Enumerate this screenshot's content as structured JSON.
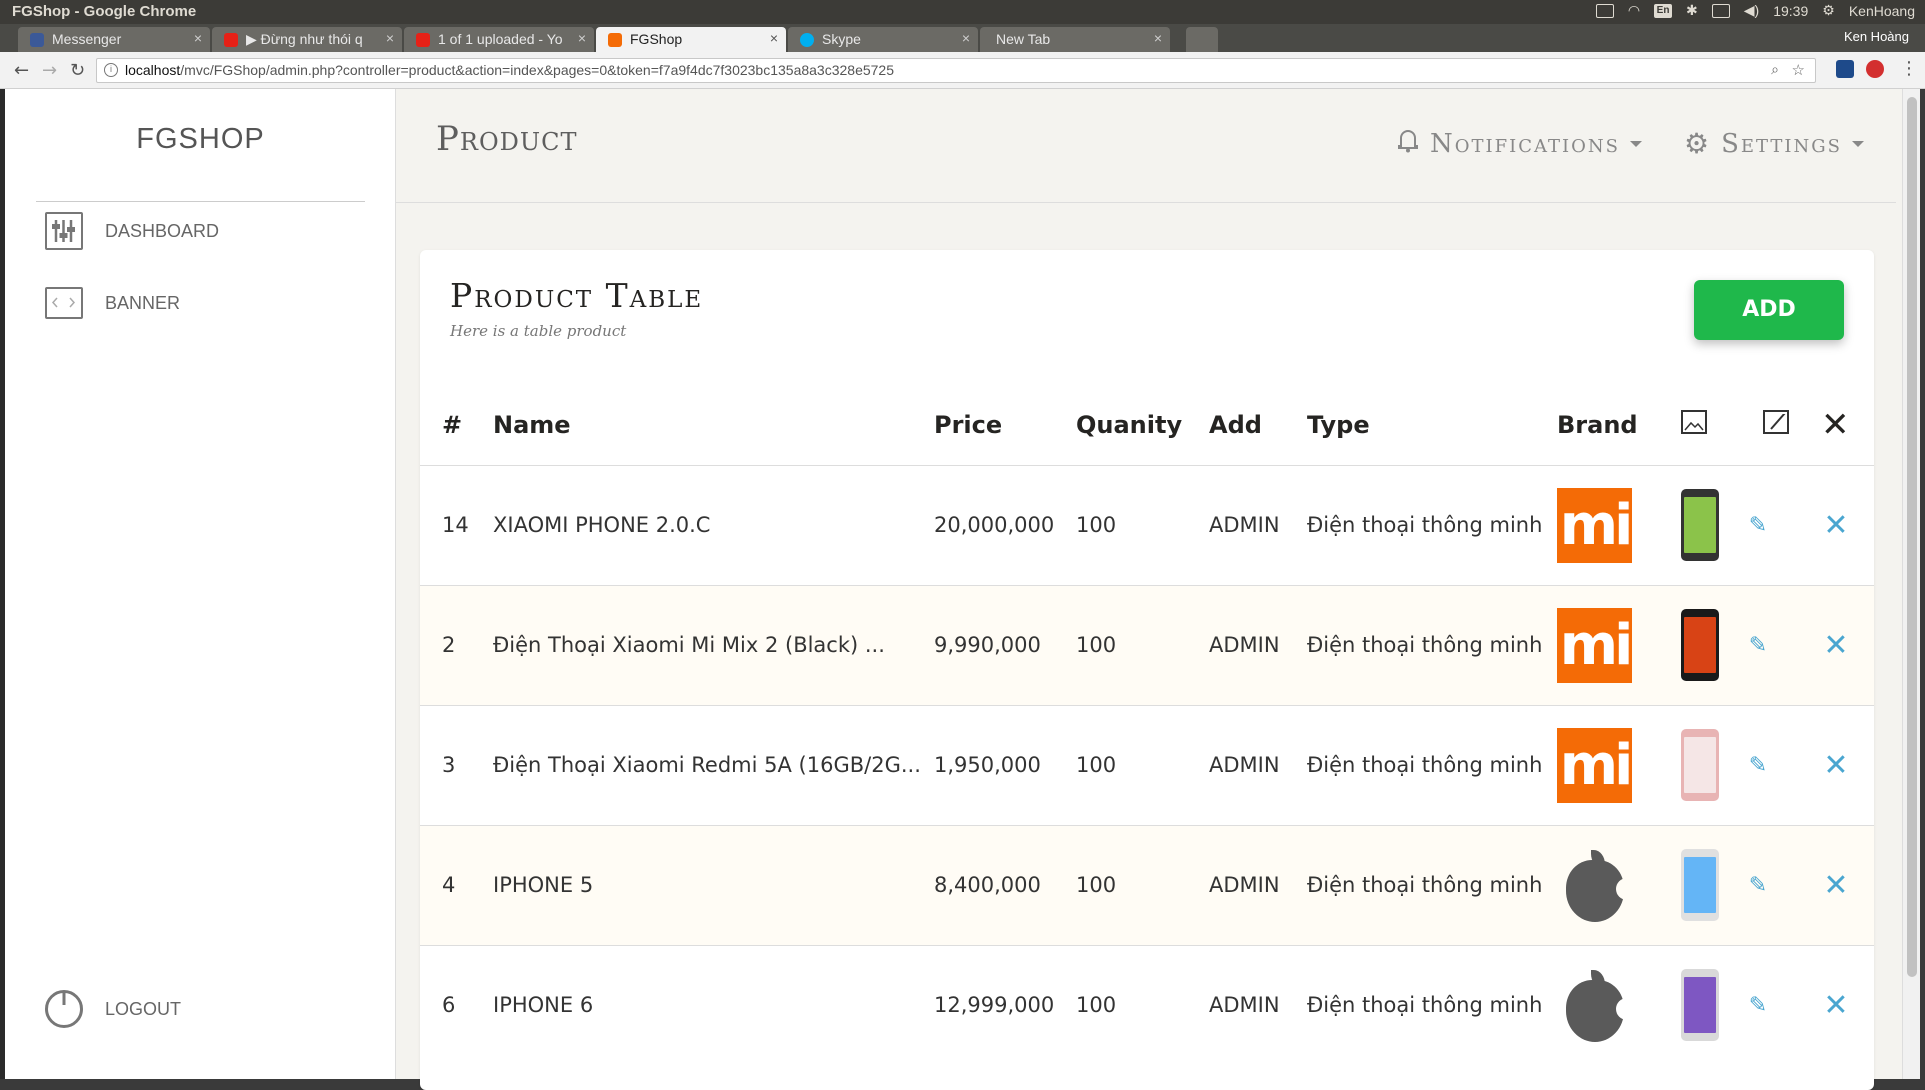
{
  "os": {
    "window_title": "FGShop - Google Chrome",
    "lang": "En",
    "time": "19:39",
    "user": "KenHoang"
  },
  "browser": {
    "tabs": [
      {
        "label": "Messenger",
        "favicon_color": "#3b5998"
      },
      {
        "label": "▶ Đừng như thói q",
        "favicon_color": "#e62117"
      },
      {
        "label": "1 of 1 uploaded - Yo",
        "favicon_color": "#e62117"
      },
      {
        "label": "FGShop",
        "favicon_color": "#f46b06",
        "active": true
      },
      {
        "label": "Skype",
        "favicon_color": "#00aff0"
      },
      {
        "label": "New Tab",
        "favicon_color": ""
      }
    ],
    "profile": "Ken Hoàng",
    "url_host": "localhost",
    "url_path": "/mvc/FGShop/admin.php?controller=product&action=index&pages=0&token=f7a9f4dc7f3023bc135a8a3c328e5725"
  },
  "sidebar": {
    "brand": "FGSHOP",
    "items": [
      {
        "label": "DASHBOARD",
        "icon": "sliders-icon"
      },
      {
        "label": "BANNER",
        "icon": "banner-icon"
      }
    ],
    "logout": {
      "label": "LOGOUT",
      "icon": "power-icon"
    }
  },
  "header": {
    "title": "Product",
    "notifications": "Notifications",
    "settings": "Settings"
  },
  "card": {
    "title": "Product Table",
    "subtitle": "Here is a table product",
    "add_label": "ADD"
  },
  "table": {
    "headers": [
      "#",
      "Name",
      "Price",
      "Quanity",
      "Add",
      "Type",
      "Brand"
    ],
    "rows": [
      {
        "id": "14",
        "name": "XIAOMI PHONE 2.0.C",
        "price": "20,000,000",
        "qty": "100",
        "add": "ADMIN",
        "type": "Điện thoại thông minh",
        "brand": "MI",
        "phone_color": "#333333",
        "screen_color": "#8bc34a"
      },
      {
        "id": "2",
        "name": "Điện Thoại Xiaomi Mi Mix 2 (Black) ...",
        "price": "9,990,000",
        "qty": "100",
        "add": "ADMIN",
        "type": "Điện thoại thông minh",
        "brand": "MI",
        "phone_color": "#1a1a1a",
        "screen_color": "#d84315"
      },
      {
        "id": "3",
        "name": "Điện Thoại Xiaomi Redmi 5A (16GB/2G...",
        "price": "1,950,000",
        "qty": "100",
        "add": "ADMIN",
        "type": "Điện thoại thông minh",
        "brand": "MI",
        "phone_color": "#e8b4b4",
        "screen_color": "#f5e6e6"
      },
      {
        "id": "4",
        "name": "IPHONE 5",
        "price": "8,400,000",
        "qty": "100",
        "add": "ADMIN",
        "type": "Điện thoại thông minh",
        "brand": "APPLE",
        "phone_color": "#e0e0e0",
        "screen_color": "#64b5f6"
      },
      {
        "id": "6",
        "name": "IPHONE 6",
        "price": "12,999,000",
        "qty": "100",
        "add": "ADMIN",
        "type": "Điện thoại thông minh",
        "brand": "APPLE",
        "phone_color": "#d9d9d9",
        "screen_color": "#7e57c2"
      }
    ]
  }
}
